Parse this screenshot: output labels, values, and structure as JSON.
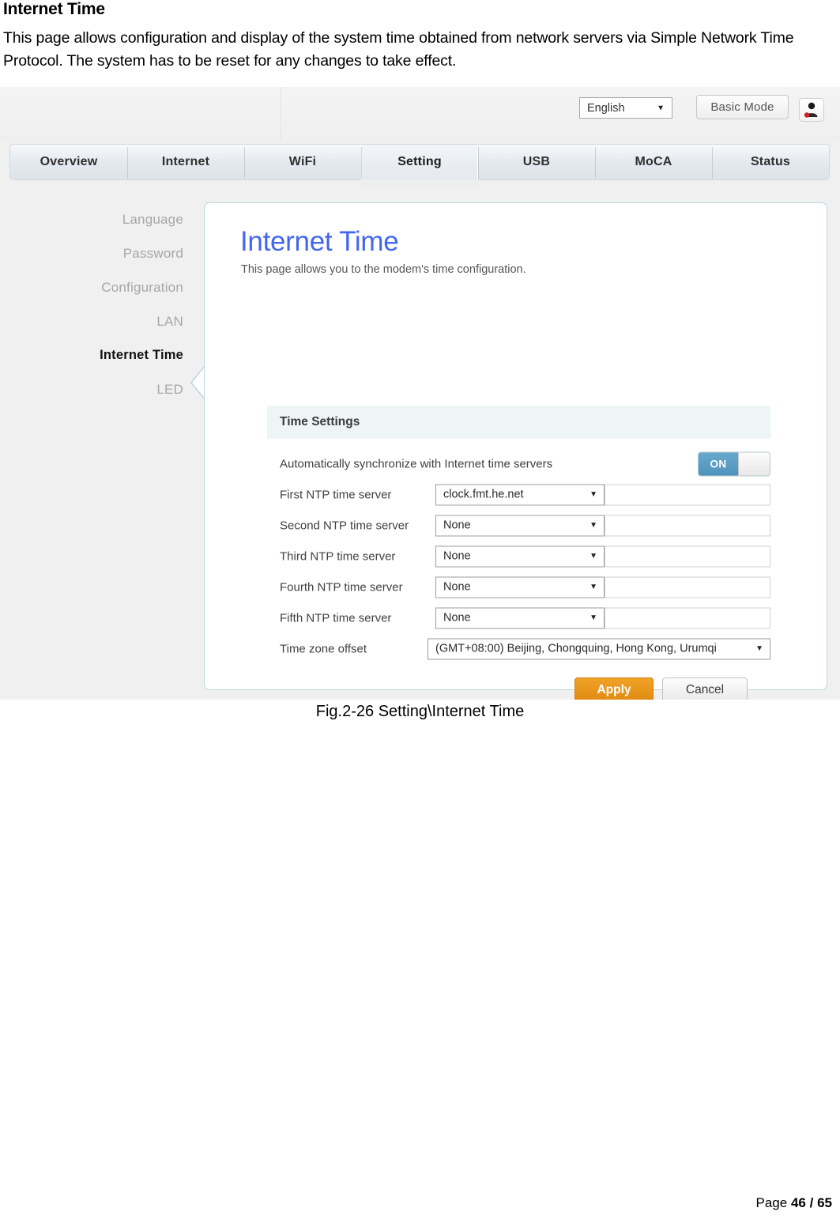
{
  "document": {
    "title": "Internet Time",
    "paragraph": "This page allows configuration and display of the system time obtained from network servers via Simple Network Time Protocol. The system has to be reset for any changes to take effect.",
    "figure_caption": "Fig.2-26 Setting\\Internet Time",
    "footer_label": "Page",
    "footer_page": "46",
    "footer_sep": "/",
    "footer_total": "65"
  },
  "router_ui": {
    "header": {
      "language_value": "English",
      "language_caret": "▼",
      "basic_mode_label": "Basic Mode",
      "avatar_icon": "user-account-icon"
    },
    "tabs": [
      {
        "label": "Overview",
        "active": false
      },
      {
        "label": "Internet",
        "active": false
      },
      {
        "label": "WiFi",
        "active": false
      },
      {
        "label": "Setting",
        "active": true
      },
      {
        "label": "USB",
        "active": false
      },
      {
        "label": "MoCA",
        "active": false
      },
      {
        "label": "Status",
        "active": false
      }
    ],
    "sidebar": [
      {
        "label": "Language",
        "active": false
      },
      {
        "label": "Password",
        "active": false
      },
      {
        "label": "Configuration",
        "active": false
      },
      {
        "label": "LAN",
        "active": false
      },
      {
        "label": "Internet Time",
        "active": true
      },
      {
        "label": "LED",
        "active": false
      }
    ],
    "panel": {
      "title": "Internet Time",
      "subtitle": "This page allows you to the modem's time configuration.",
      "section_header": "Time Settings",
      "auto_sync": {
        "label": "Automatically synchronize with Internet time servers",
        "toggle_state": "ON"
      },
      "rows": [
        {
          "label": "First NTP time server",
          "select_value": "clock.fmt.he.net",
          "text_value": ""
        },
        {
          "label": "Second NTP time server",
          "select_value": "None",
          "text_value": ""
        },
        {
          "label": "Third NTP time server",
          "select_value": "None",
          "text_value": ""
        },
        {
          "label": "Fourth NTP time server",
          "select_value": "None",
          "text_value": ""
        },
        {
          "label": "Fifth NTP time server",
          "select_value": "None",
          "text_value": ""
        }
      ],
      "timezone": {
        "label": "Time zone offset",
        "value": "(GMT+08:00) Beijing, Chongquing, Hong Kong, Urumqi"
      },
      "caret": "▼",
      "apply_label": "Apply",
      "cancel_label": "Cancel"
    },
    "colors": {
      "accent_blue": "#4466ee",
      "apply_orange": "#e08910",
      "toggle_blue": "#4f93bd",
      "panel_border": "#bdd7e0",
      "band_bg": "#eef6f5",
      "page_bg": "#f0f0f0"
    }
  }
}
